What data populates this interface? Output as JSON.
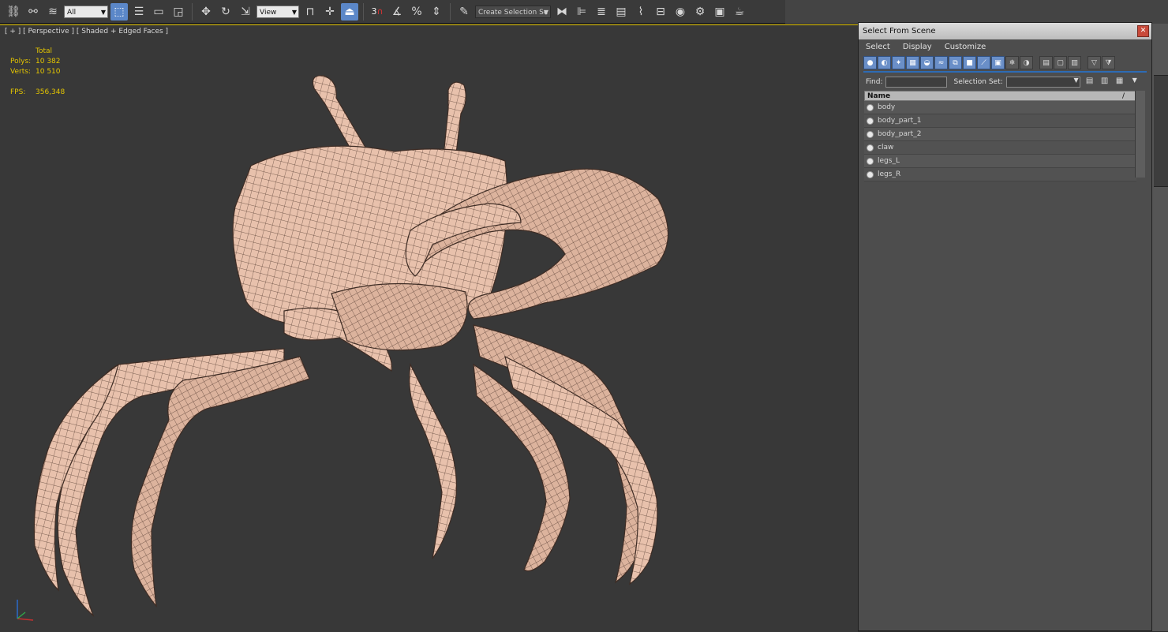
{
  "toolbar": {
    "selection_filter": "All",
    "reference_coord": "View",
    "named_selection_placeholder": "Create Selection Se",
    "snap_3d_label": "3",
    "icons": [
      "select-and-link-icon",
      "unlink-icon",
      "bind-space-warp-icon",
      "select-object-icon",
      "select-by-name-icon",
      "rect-selection-icon",
      "window-crossing-icon",
      "move-icon",
      "rotate-icon",
      "scale-icon",
      "pivot-icon",
      "manipulate-icon",
      "snap-toggle-icon",
      "angle-snap-icon",
      "percent-snap-icon",
      "spinner-snap-icon",
      "edit-named-sets-icon",
      "mirror-icon",
      "align-icon",
      "layer-explorer-icon",
      "toggle-ribbon-icon",
      "curve-editor-icon",
      "schematic-view-icon",
      "material-editor-icon",
      "render-setup-icon",
      "rendered-frame-icon",
      "render-icon"
    ]
  },
  "viewport": {
    "label": "[ + ] [ Perspective ] [ Shaded + Edged Faces ]",
    "stats": {
      "total_label": "Total",
      "polys_label": "Polys:",
      "polys_value": "10 382",
      "verts_label": "Verts:",
      "verts_value": "10 510",
      "fps_label": "FPS:",
      "fps_value": "356,348"
    }
  },
  "dialog": {
    "title": "Select From Scene",
    "menu": [
      "Select",
      "Display",
      "Customize"
    ],
    "find_label": "Find:",
    "selection_set_label": "Selection Set:",
    "column_name": "Name",
    "column_sort": "/",
    "objects": [
      "body",
      "body_part_1",
      "body_part_2",
      "claw",
      "legs_L",
      "legs_R"
    ]
  },
  "colors": {
    "mesh": "#e8c1ac",
    "wire": "#5a4136",
    "stats_text": "#e4c500",
    "active_button": "#5b87c8"
  }
}
